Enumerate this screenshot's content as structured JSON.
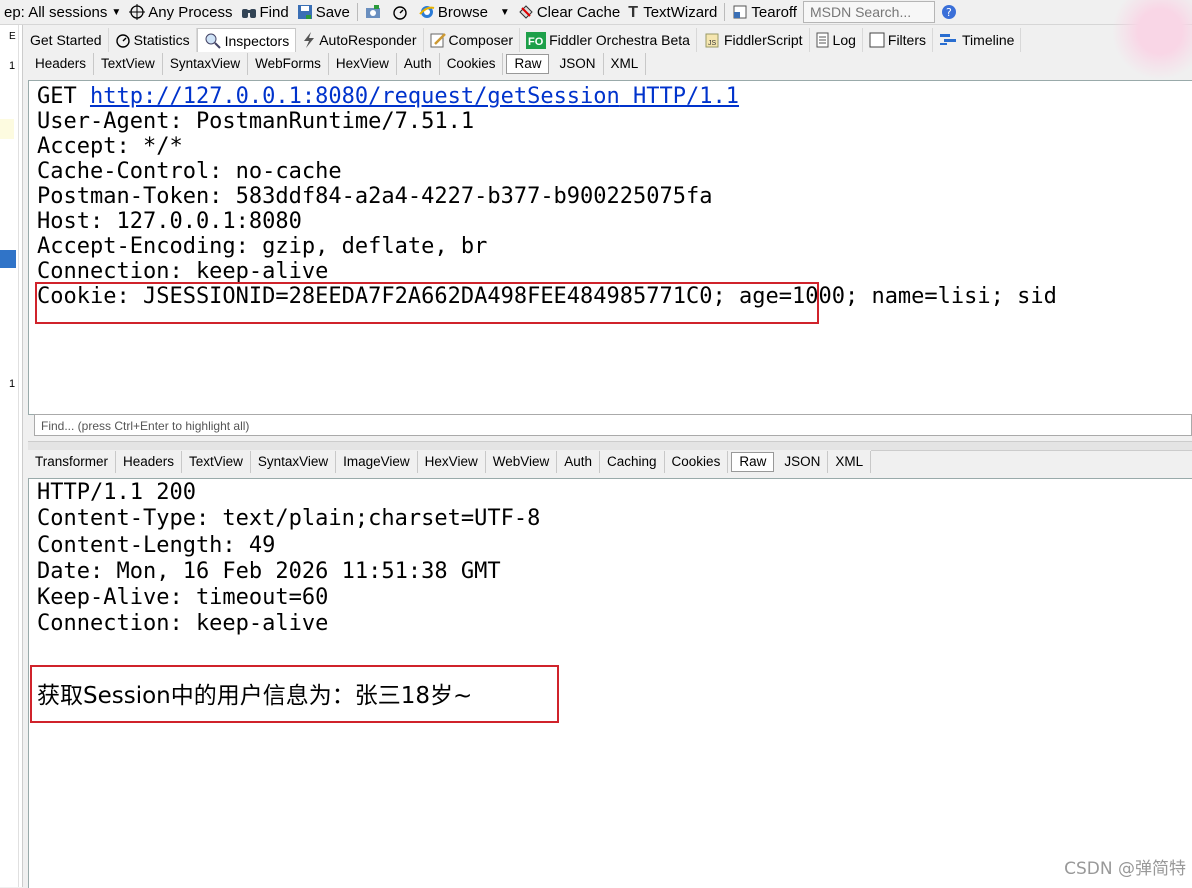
{
  "toolbar": {
    "keep_label": "ep: All sessions",
    "process_label": "Any Process",
    "find_label": "Find",
    "save_label": "Save",
    "browse_label": "Browse",
    "clear_cache_label": "Clear Cache",
    "textwizard_label": "TextWizard",
    "tearoff_label": "Tearoff",
    "msdn_placeholder": "MSDN Search..."
  },
  "left_strip": {
    "marker_top": "1",
    "marker_bottom": "1"
  },
  "main_tabs": [
    {
      "label": "Get Started",
      "icon": "none"
    },
    {
      "label": "Statistics",
      "icon": "stopwatch-icon"
    },
    {
      "label": "Inspectors",
      "icon": "magnifier-icon"
    },
    {
      "label": "AutoResponder",
      "icon": "lightning-icon"
    },
    {
      "label": "Composer",
      "icon": "pencil-icon"
    },
    {
      "label": "Fiddler Orchestra Beta",
      "icon": "fo-icon",
      "badge": "FO"
    },
    {
      "label": "FiddlerScript",
      "icon": "js-icon"
    },
    {
      "label": "Log",
      "icon": "log-icon"
    },
    {
      "label": "Filters",
      "icon": "checkbox-icon"
    },
    {
      "label": "Timeline",
      "icon": "timeline-icon"
    }
  ],
  "request_tabs": [
    "Headers",
    "TextView",
    "SyntaxView",
    "WebForms",
    "HexView",
    "Auth",
    "Cookies",
    "Raw",
    "JSON",
    "XML"
  ],
  "request_active_tab": "Raw",
  "request": {
    "method": "GET ",
    "url": "http://127.0.0.1:8080/request/getSession",
    "protocol": " HTTP/1.1",
    "headers": [
      "User-Agent: PostmanRuntime/7.51.1",
      "Accept: */*",
      "Cache-Control: no-cache",
      "Postman-Token: 583ddf84-a2a4-4227-b377-b900225075fa",
      "Host: 127.0.0.1:8080",
      "Accept-Encoding: gzip, deflate, br",
      "Connection: keep-alive",
      "Cookie: JSESSIONID=28EEDA7F2A662DA498FEE484985771C0; age=1000; name=lisi; sid"
    ]
  },
  "find_placeholder": "Find... (press Ctrl+Enter to highlight all)",
  "response_tabs": [
    "Transformer",
    "Headers",
    "TextView",
    "SyntaxView",
    "ImageView",
    "HexView",
    "WebView",
    "Auth",
    "Caching",
    "Cookies",
    "Raw",
    "JSON",
    "XML"
  ],
  "response_active_tab": "Raw",
  "response": {
    "lines": [
      "HTTP/1.1 200",
      "Content-Type: text/plain;charset=UTF-8",
      "Content-Length: 49",
      "Date: Mon, 16 Feb 2026 11:51:38 GMT",
      "Keep-Alive: timeout=60",
      "Connection: keep-alive"
    ],
    "body": "获取Session中的用户信息为：张三18岁~"
  },
  "watermark": "CSDN @弹简特",
  "colors": {
    "highlight_box": "#d0232b",
    "link": "#0033cc",
    "selection_blue": "#3074c8"
  }
}
